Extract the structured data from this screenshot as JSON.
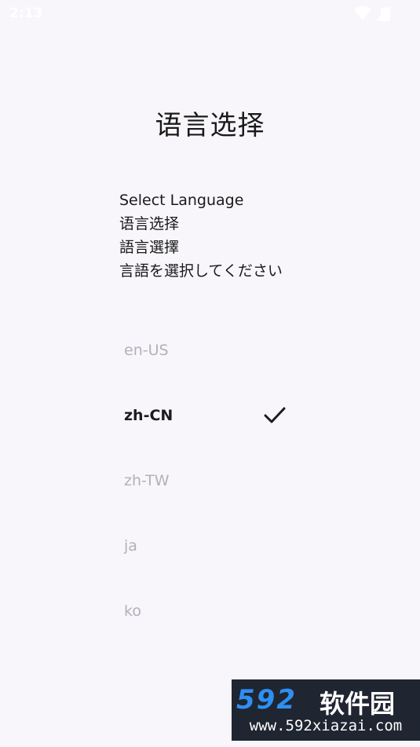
{
  "status_bar": {
    "time": "2:13",
    "icons": [
      "wifi-icon",
      "signal-icon",
      "battery-icon"
    ]
  },
  "page": {
    "title": "语言选择",
    "prompt_lines": [
      "Select Language",
      "语言选择",
      "語言選擇",
      "言語を選択してください"
    ]
  },
  "languages": [
    {
      "label": "en-US",
      "selected": false
    },
    {
      "label": "zh-CN",
      "selected": true
    },
    {
      "label": "zh-TW",
      "selected": false
    },
    {
      "label": "ja",
      "selected": false
    },
    {
      "label": "ko",
      "selected": false
    }
  ],
  "watermark": {
    "logo": "592",
    "brand": "软件园",
    "url": "www.592xiazai.com"
  },
  "colors": {
    "background": "#f8f6fb",
    "selected_text": "#1d1b20",
    "unselected_text": "#b3b1b8"
  }
}
